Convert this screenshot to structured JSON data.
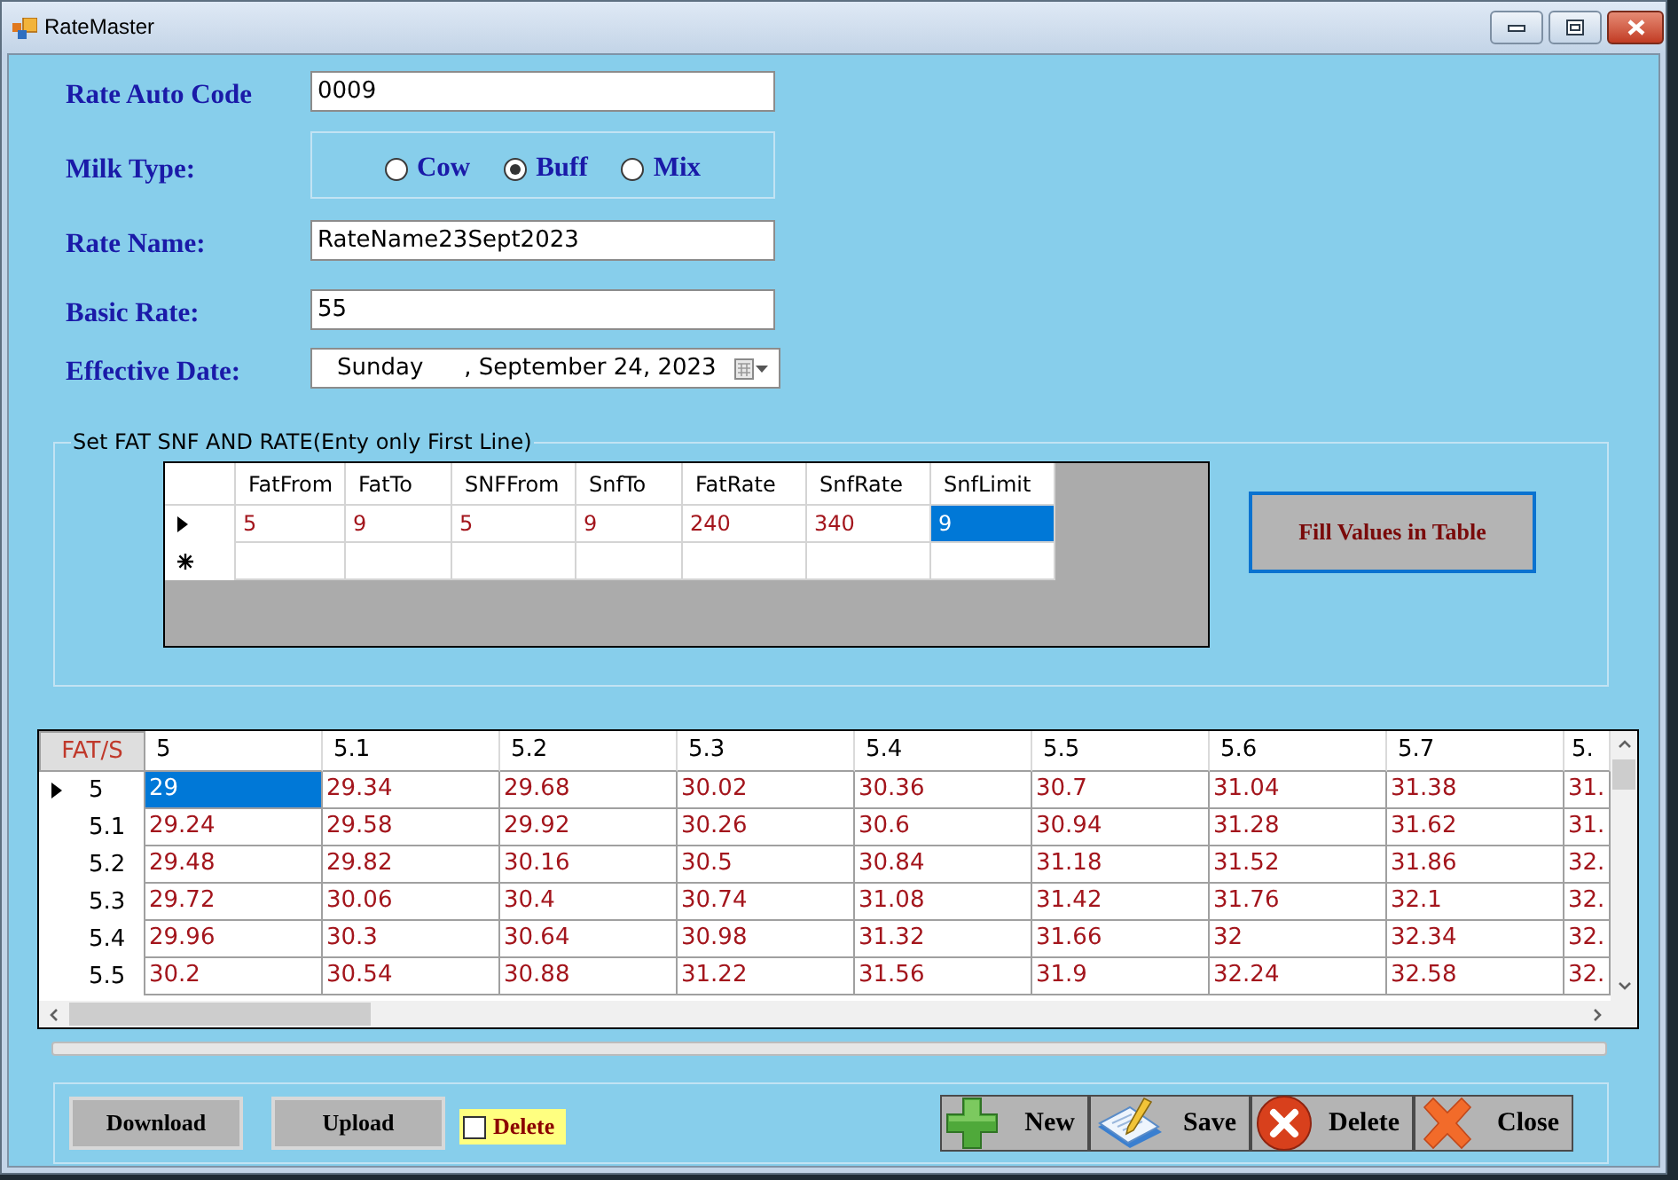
{
  "window": {
    "title": "RateMaster"
  },
  "form": {
    "rate_auto_code": {
      "label": "Rate Auto Code",
      "value": "0009"
    },
    "milk_type": {
      "label": "Milk Type:",
      "options": [
        {
          "label": "Cow",
          "selected": false
        },
        {
          "label": "Buff",
          "selected": true
        },
        {
          "label": "Mix",
          "selected": false
        }
      ]
    },
    "rate_name": {
      "label": "Rate Name:",
      "value": "RateName23Sept2023"
    },
    "basic_rate": {
      "label": "Basic Rate:",
      "value": "55"
    },
    "effective_date": {
      "label": "Effective Date:",
      "day": "Sunday",
      "date": ", September 24, 2023"
    }
  },
  "rate_entry": {
    "title": "Set FAT SNF AND RATE(Enty only First Line)",
    "columns": [
      "FatFrom",
      "FatTo",
      "SNFFrom",
      "SnfTo",
      "FatRate",
      "SnfRate",
      "SnfLimit"
    ],
    "rows": [
      {
        "kind": "current",
        "cells": [
          {
            "value": "5",
            "selected": false
          },
          {
            "value": "9",
            "selected": false
          },
          {
            "value": "5",
            "selected": false
          },
          {
            "value": "9",
            "selected": false
          },
          {
            "value": "240",
            "selected": false
          },
          {
            "value": "340",
            "selected": false
          },
          {
            "value": "9",
            "selected": true
          }
        ]
      },
      {
        "kind": "new"
      }
    ],
    "fill_button": "Fill Values in Table"
  },
  "rate_table": {
    "corner": "FAT/S",
    "columns": [
      "5",
      "5.1",
      "5.2",
      "5.3",
      "5.4",
      "5.5",
      "5.6",
      "5.7",
      "5."
    ],
    "rows": [
      {
        "label": "5",
        "current": true,
        "cells": [
          {
            "value": "29",
            "selected": true
          },
          {
            "value": "29.34",
            "selected": false
          },
          {
            "value": "29.68",
            "selected": false
          },
          {
            "value": "30.02",
            "selected": false
          },
          {
            "value": "30.36",
            "selected": false
          },
          {
            "value": "30.7",
            "selected": false
          },
          {
            "value": "31.04",
            "selected": false
          },
          {
            "value": "31.38",
            "selected": false
          },
          {
            "value": "31.",
            "selected": false
          }
        ]
      },
      {
        "label": "5.1",
        "current": false,
        "cells": [
          {
            "value": "29.24",
            "selected": false
          },
          {
            "value": "29.58",
            "selected": false
          },
          {
            "value": "29.92",
            "selected": false
          },
          {
            "value": "30.26",
            "selected": false
          },
          {
            "value": "30.6",
            "selected": false
          },
          {
            "value": "30.94",
            "selected": false
          },
          {
            "value": "31.28",
            "selected": false
          },
          {
            "value": "31.62",
            "selected": false
          },
          {
            "value": "31.",
            "selected": false
          }
        ]
      },
      {
        "label": "5.2",
        "current": false,
        "cells": [
          {
            "value": "29.48",
            "selected": false
          },
          {
            "value": "29.82",
            "selected": false
          },
          {
            "value": "30.16",
            "selected": false
          },
          {
            "value": "30.5",
            "selected": false
          },
          {
            "value": "30.84",
            "selected": false
          },
          {
            "value": "31.18",
            "selected": false
          },
          {
            "value": "31.52",
            "selected": false
          },
          {
            "value": "31.86",
            "selected": false
          },
          {
            "value": "32.",
            "selected": false
          }
        ]
      },
      {
        "label": "5.3",
        "current": false,
        "cells": [
          {
            "value": "29.72",
            "selected": false
          },
          {
            "value": "30.06",
            "selected": false
          },
          {
            "value": "30.4",
            "selected": false
          },
          {
            "value": "30.74",
            "selected": false
          },
          {
            "value": "31.08",
            "selected": false
          },
          {
            "value": "31.42",
            "selected": false
          },
          {
            "value": "31.76",
            "selected": false
          },
          {
            "value": "32.1",
            "selected": false
          },
          {
            "value": "32.",
            "selected": false
          }
        ]
      },
      {
        "label": "5.4",
        "current": false,
        "cells": [
          {
            "value": "29.96",
            "selected": false
          },
          {
            "value": "30.3",
            "selected": false
          },
          {
            "value": "30.64",
            "selected": false
          },
          {
            "value": "30.98",
            "selected": false
          },
          {
            "value": "31.32",
            "selected": false
          },
          {
            "value": "31.66",
            "selected": false
          },
          {
            "value": "32",
            "selected": false
          },
          {
            "value": "32.34",
            "selected": false
          },
          {
            "value": "32.",
            "selected": false
          }
        ]
      },
      {
        "label": "5.5",
        "current": false,
        "cells": [
          {
            "value": "30.2",
            "selected": false
          },
          {
            "value": "30.54",
            "selected": false
          },
          {
            "value": "30.88",
            "selected": false
          },
          {
            "value": "31.22",
            "selected": false
          },
          {
            "value": "31.56",
            "selected": false
          },
          {
            "value": "31.9",
            "selected": false
          },
          {
            "value": "32.24",
            "selected": false
          },
          {
            "value": "32.58",
            "selected": false
          },
          {
            "value": "32.",
            "selected": false
          }
        ]
      }
    ]
  },
  "footer": {
    "download_button": "Download",
    "upload_button": "Upload",
    "delete_checkbox": {
      "label": "Delete",
      "checked": false
    },
    "actions": [
      {
        "kind": "new",
        "label": "New"
      },
      {
        "kind": "save",
        "label": "Save"
      },
      {
        "kind": "delete",
        "label": "Delete"
      },
      {
        "kind": "close",
        "label": "Close"
      }
    ]
  }
}
